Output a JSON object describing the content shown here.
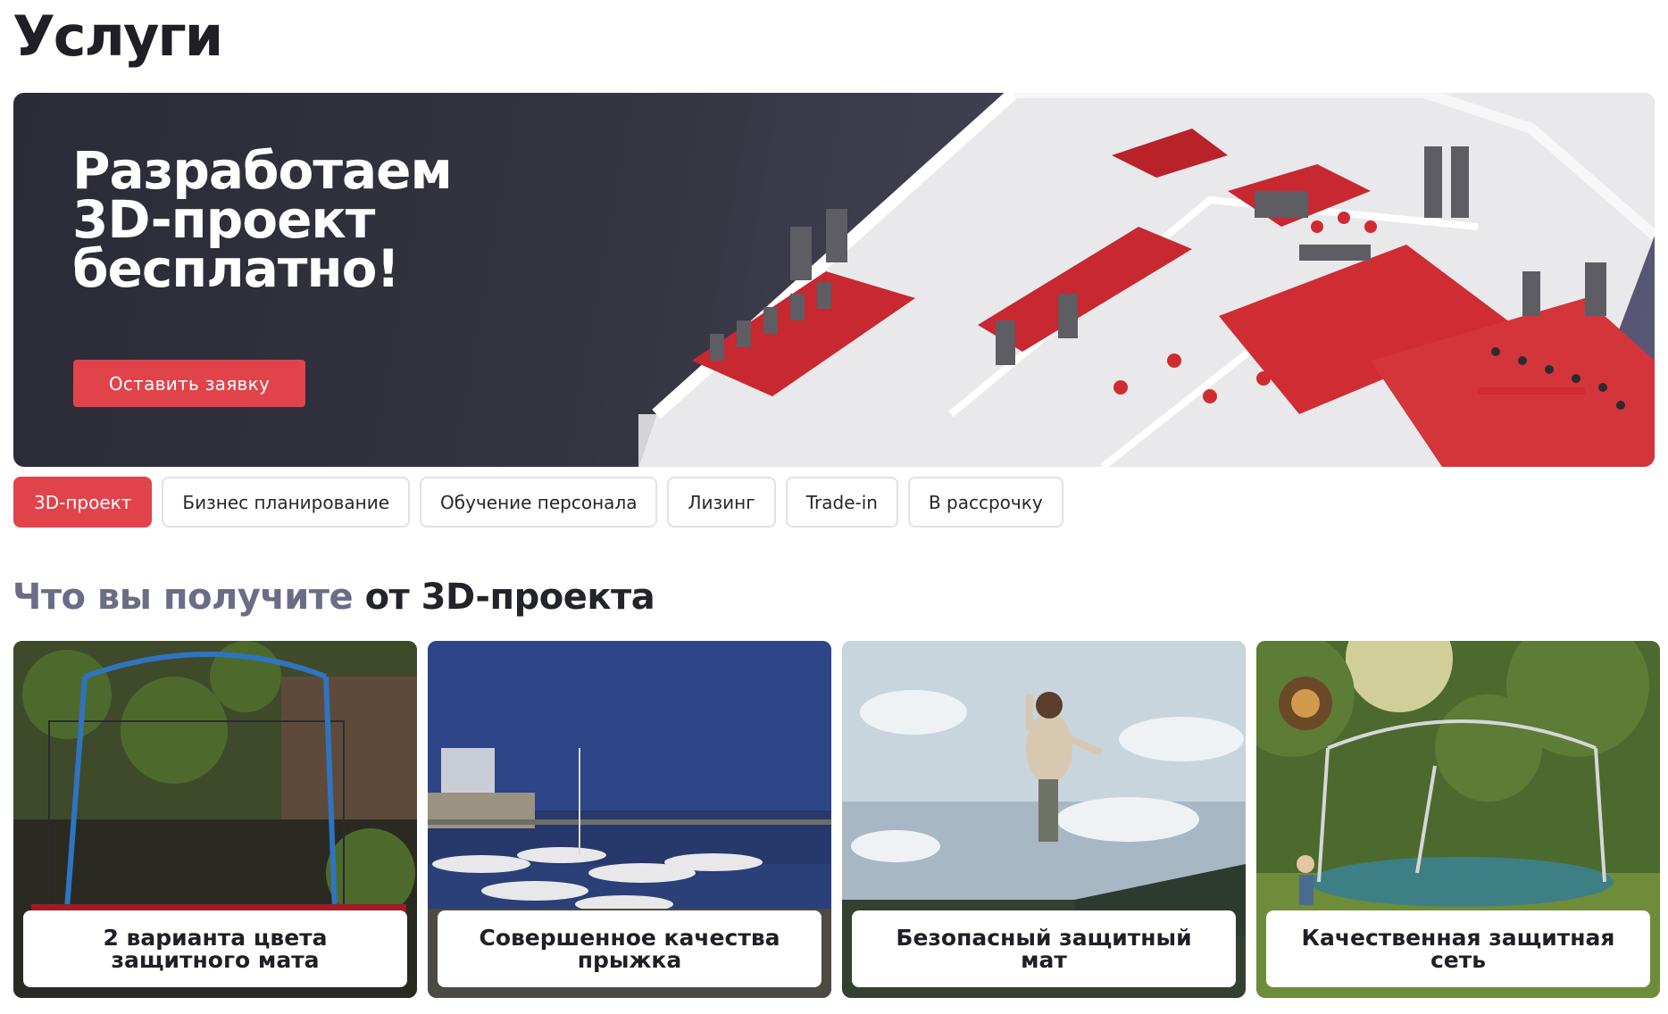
{
  "page": {
    "title": "Услуги"
  },
  "hero": {
    "title_lines": [
      "Разработаем",
      "3D-проект",
      "бесплатно!"
    ],
    "button_label": "Оставить заявку",
    "image_icon": "gym-3d-render"
  },
  "tabs": [
    {
      "label": "3D-проект",
      "active": true
    },
    {
      "label": "Бизнес планирование",
      "active": false
    },
    {
      "label": "Обучение персонала",
      "active": false
    },
    {
      "label": "Лизинг",
      "active": false
    },
    {
      "label": "Trade-in",
      "active": false
    },
    {
      "label": "В рассрочку",
      "active": false
    }
  ],
  "section": {
    "heading_muted": "Что вы получите",
    "heading_dark": "от 3D-проекта"
  },
  "cards": [
    {
      "label": "2 варианта цвета защитного мата",
      "image": "trampoline-garden-photo"
    },
    {
      "label": "Совершенное качества прыжка",
      "image": "marina-photo"
    },
    {
      "label": "Безопасный защитный мат",
      "image": "jumping-woman-photo"
    },
    {
      "label": "Качественная защитная сеть",
      "image": "trampoline-sunset-photo"
    }
  ],
  "colors": {
    "accent": "#e1434b",
    "hero_bg": "#34343f",
    "heading_muted": "#6b6d87"
  }
}
